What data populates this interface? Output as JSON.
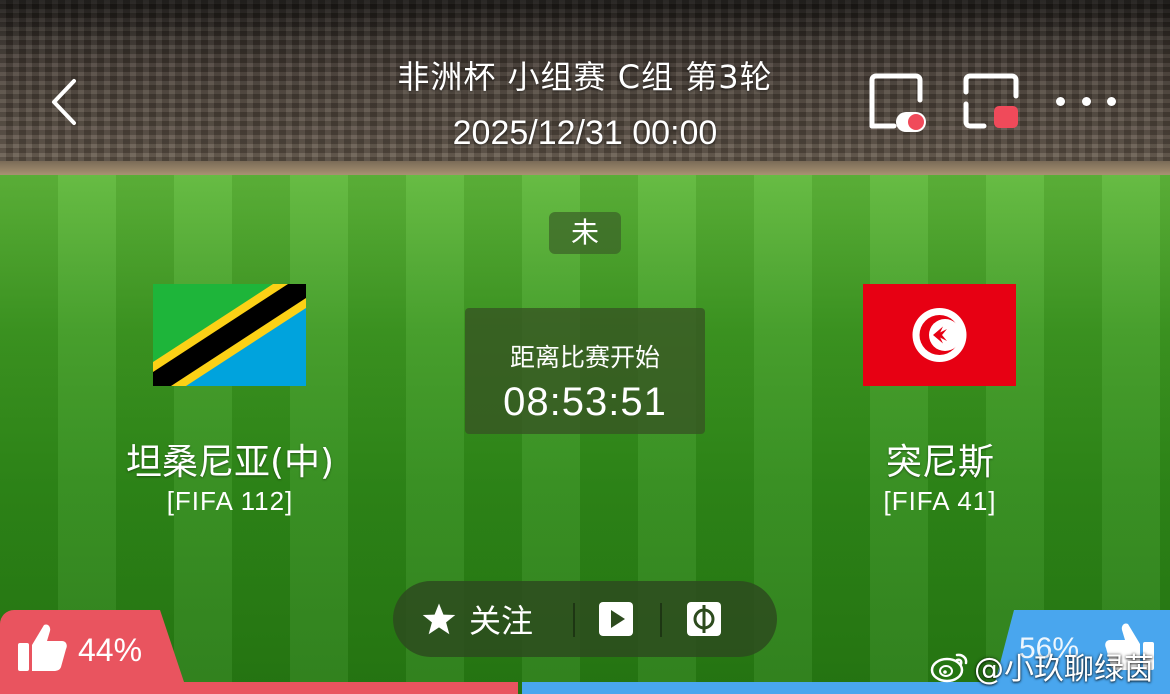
{
  "header": {
    "title": "非洲杯 小组赛 C组 第3轮",
    "datetime": "2025/12/31 00:00"
  },
  "match": {
    "status": "未",
    "countdown_label": "距离比赛开始",
    "countdown_value": "08:53:51",
    "home": {
      "name": "坦桑尼亚(中)",
      "rank": "[FIFA 112]",
      "flag": "tanzania-flag"
    },
    "away": {
      "name": "突尼斯",
      "rank": "[FIFA 41]",
      "flag": "tunisia-flag"
    }
  },
  "actions": {
    "follow_label": "关注"
  },
  "votes": {
    "home_pct": "44%",
    "away_pct": "56%",
    "home_color": "#e9545f",
    "away_color": "#49a6ee"
  },
  "watermark": {
    "text": "@小玖聊绿茵"
  }
}
